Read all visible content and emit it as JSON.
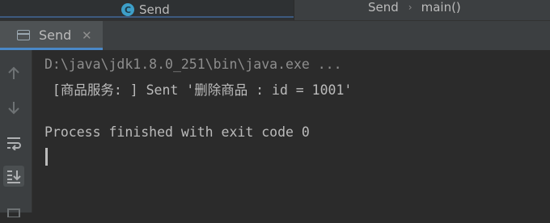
{
  "editor": {
    "tab_label": "Send",
    "breadcrumbs": [
      "Send",
      "main()"
    ]
  },
  "run_tool": {
    "tab_label": "Send",
    "close_glyph": "✕"
  },
  "gutter": {
    "icons": [
      "arrow-up-icon",
      "arrow-down-icon",
      "soft-wrap-icon",
      "scroll-to-end-icon"
    ]
  },
  "console": {
    "lines": [
      "D:\\java\\jdk1.8.0_251\\bin\\java.exe ...",
      " [商品服务: ] Sent '删除商品 : id = 1001'",
      "",
      "Process finished with exit code 0"
    ]
  }
}
